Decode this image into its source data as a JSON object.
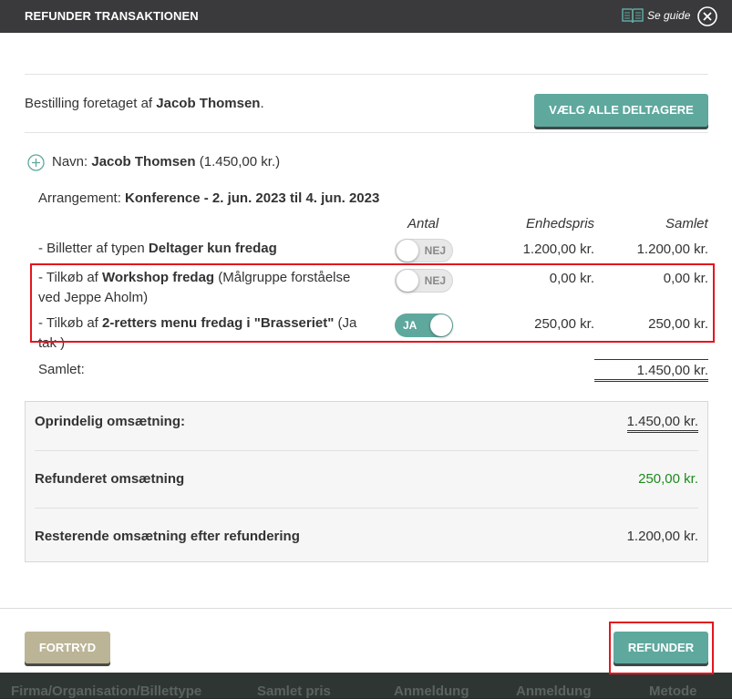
{
  "dialog": {
    "title": "REFUNDER TRANSAKTIONEN",
    "guide_label": "Se guide",
    "guide_icon": "book-icon",
    "close_icon": "close-icon"
  },
  "booking": {
    "prefix": "Bestilling foretaget af ",
    "name": "Jacob Thomsen",
    "suffix": ".",
    "select_all_label": "VÆLG ALLE DELTAGERE"
  },
  "participant": {
    "name_prefix": "Navn: ",
    "name": "Jacob Thomsen",
    "amount": " (1.450,00 kr.)",
    "event_prefix": "Arrangement: ",
    "event": "Konference - 2. jun. 2023 til 4. jun. 2023"
  },
  "columns": {
    "quantity": "Antal",
    "unit_price": "Enhedspris",
    "total": "Samlet"
  },
  "items": [
    {
      "prefix": "- Billetter af typen ",
      "bold": "Deltager kun fredag",
      "suffix": "",
      "toggle_label": "NEJ",
      "toggle_on": false,
      "unit_price": "1.200,00 kr.",
      "total": "1.200,00 kr."
    },
    {
      "prefix": "- Tilkøb af ",
      "bold": "Workshop fredag",
      "suffix": " (Målgruppe forståelse ved Jeppe Aholm)",
      "toggle_label": "NEJ",
      "toggle_on": false,
      "unit_price": "0,00 kr.",
      "total": "0,00 kr."
    },
    {
      "prefix": "- Tilkøb af ",
      "bold": "2-retters menu fredag i \"Brasseriet\"",
      "suffix": " (Ja tak )",
      "toggle_label": "JA",
      "toggle_on": true,
      "unit_price": "250,00 kr.",
      "total": "250,00 kr."
    }
  ],
  "total": {
    "label": "Samlet:",
    "value": "1.450,00 kr."
  },
  "summary": {
    "original_label": "Oprindelig omsætning:",
    "original_value": "1.450,00 kr.",
    "refunded_label": "Refunderet omsætning",
    "refunded_value": "250,00 kr.",
    "remaining_label": "Resterende omsætning efter refundering",
    "remaining_value": "1.200,00 kr."
  },
  "footer": {
    "cancel_label": "FORTRYD",
    "refund_label": "REFUNDER"
  },
  "background_columns": [
    "Firma/Organisation/Billettype",
    "Samlet pris",
    "Anmeldung",
    "Anmeldung",
    "Metode"
  ],
  "colors": {
    "accent": "#5fa89e",
    "title_bar": "#3a3a3c",
    "cancel": "#bbb497",
    "highlight": "#e4161e",
    "refunded_value": "#1e8a1e"
  }
}
